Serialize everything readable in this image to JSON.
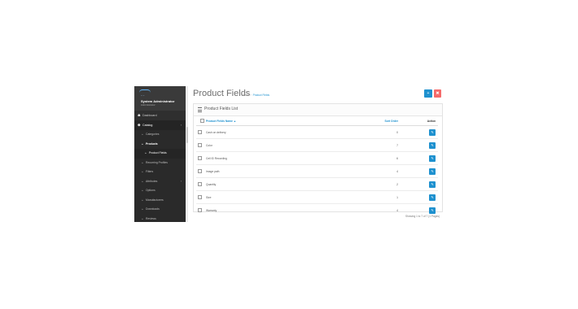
{
  "app": {
    "user_name": "System Administrator",
    "user_role": "Administrator",
    "logo_text": "~ ~"
  },
  "sidebar": {
    "items": [
      {
        "label": "Dashboard",
        "icon": "dashboard-icon",
        "glyph": "☗"
      },
      {
        "label": "Catalog",
        "icon": "tag-icon",
        "glyph": "⬣",
        "expanded_glyph": "›"
      }
    ],
    "catalog_children": [
      {
        "label": "Categories"
      },
      {
        "label": "Products"
      },
      {
        "label": "Product Fields"
      },
      {
        "label": "Recurring Profiles"
      },
      {
        "label": "Filters"
      },
      {
        "label": "Attributes",
        "chevron": "›"
      },
      {
        "label": "Options"
      },
      {
        "label": "Manufacturers"
      },
      {
        "label": "Downloads"
      },
      {
        "label": "Reviews"
      }
    ]
  },
  "header": {
    "title": "Product Fields",
    "breadcrumb_home": "Home",
    "breadcrumb_sep": "›",
    "breadcrumb_current": "Product Fields",
    "add_glyph": "+",
    "delete_glyph": "✖"
  },
  "panel": {
    "title": "Product Fields List"
  },
  "table": {
    "col_name": "Product Fields Name ▲",
    "col_sort": "Sort Order",
    "col_action": "Action",
    "edit_glyph": "✎",
    "rows": [
      {
        "name": "Cash on delivery",
        "sort": "0"
      },
      {
        "name": "Color",
        "sort": "7"
      },
      {
        "name": "Cell ID Recording",
        "sort": "6"
      },
      {
        "name": "Image path",
        "sort": "4"
      },
      {
        "name": "Quantity",
        "sort": "2"
      },
      {
        "name": "Size",
        "sort": "1"
      },
      {
        "name": "Warranty",
        "sort": "4"
      }
    ]
  },
  "footer": {
    "pagination_text": "Showing 1 to 7 of 7 (1 Pages)"
  },
  "colors": {
    "accent": "#1e91cf",
    "danger": "#f56b6b",
    "sidebar": "#2f2f2f"
  }
}
